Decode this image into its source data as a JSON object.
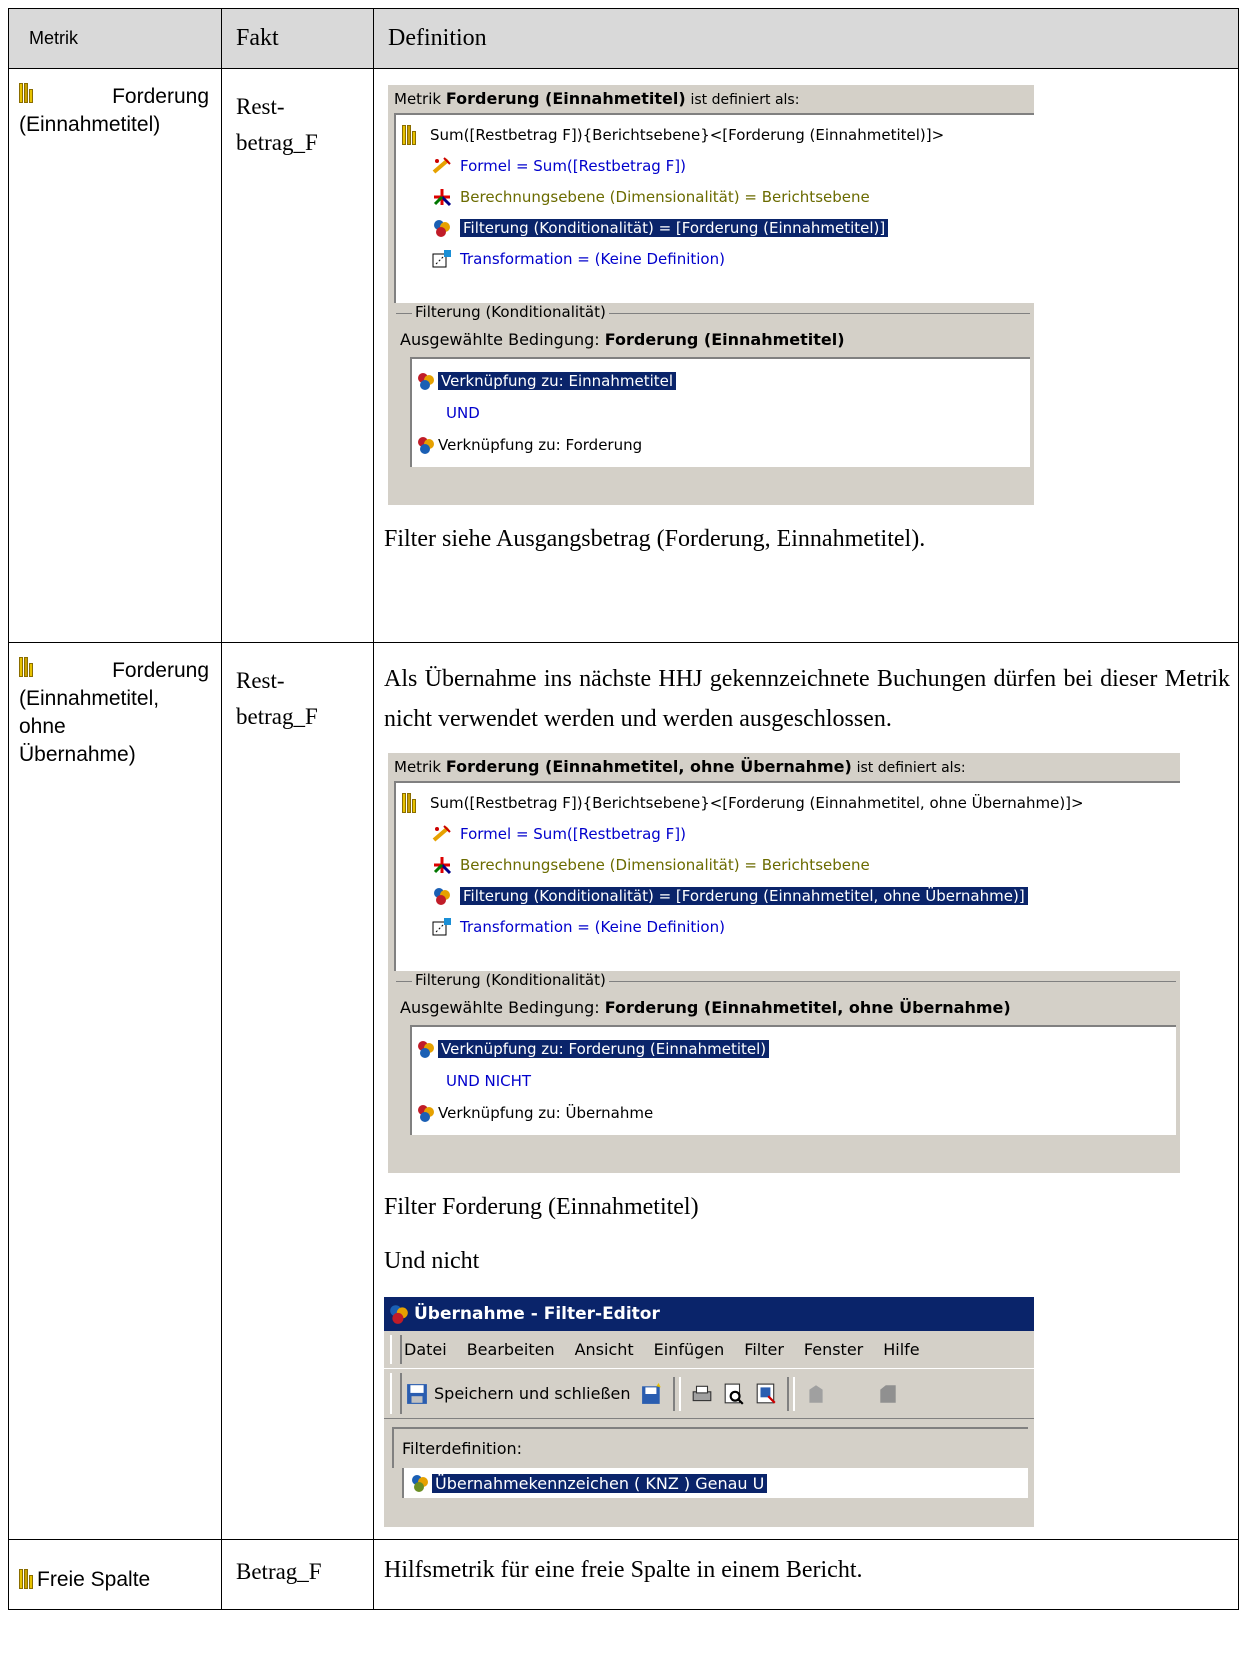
{
  "table": {
    "headers": {
      "metrik": "Metrik",
      "fakt": "Fakt",
      "definition": "Definition"
    },
    "rows": [
      {
        "metric_line1": "Forderung",
        "metric_line2": "(Einnahmetitel)",
        "fakt_line1": "Rest-",
        "fakt_line2": "betrag_F",
        "panel": {
          "header_prefix": "Metrik",
          "header_name": "Forderung (Einnahmetitel)",
          "header_suffix": "ist definiert als:",
          "tree_root": "Sum([Restbetrag F]){Berichtsebene}<[Forderung (Einnahmetitel)]>",
          "tree_formel": "Formel = Sum([Restbetrag F])",
          "tree_berechnung": "Berechnungsebene (Dimensionalität) = Berichtsebene",
          "tree_filterung": "Filterung (Konditionalität) = [Forderung (Einnahmetitel)]",
          "tree_transformation": "Transformation = (Keine Definition)",
          "group_title": "Filterung (Konditionalität)",
          "cond_label": "Ausgewählte Bedingung:",
          "cond_value": "Forderung (Einnahmetitel)",
          "cond_row1": "Verknüpfung zu: Einnahmetitel",
          "cond_op": "UND",
          "cond_row2": "Verknüpfung zu: Forderung"
        },
        "note": "Filter siehe Ausgangsbetrag (Forderung, Einnahmetitel)."
      },
      {
        "metric_line1": "Forderung",
        "metric_line2": "(Einnahmetitel,",
        "metric_line3": "ohne",
        "metric_line4": "Übernahme)",
        "fakt_line1": "Rest-",
        "fakt_line2": "betrag_F",
        "intro": "Als Übernahme ins nächste HHJ gekennzeichnete Buchungen dürfen bei dieser Metrik nicht verwendet werden und werden ausgeschlossen.",
        "panel": {
          "header_prefix": "Metrik",
          "header_name": "Forderung (Einnahmetitel, ohne Übernahme)",
          "header_suffix": "ist definiert als:",
          "tree_root": "Sum([Restbetrag F]){Berichtsebene}<[Forderung (Einnahmetitel, ohne Übernahme)]>",
          "tree_formel": "Formel = Sum([Restbetrag F])",
          "tree_berechnung": "Berechnungsebene (Dimensionalität) = Berichtsebene",
          "tree_filterung": "Filterung (Konditionalität) = [Forderung (Einnahmetitel, ohne Übernahme)]",
          "tree_transformation": "Transformation = (Keine Definition)",
          "group_title": "Filterung (Konditionalität)",
          "cond_label": "Ausgewählte Bedingung:",
          "cond_value": "Forderung (Einnahmetitel, ohne Übernahme)",
          "cond_row1": "Verknüpfung zu: Forderung (Einnahmetitel)",
          "cond_op": "UND NICHT",
          "cond_row2": "Verknüpfung zu: Übernahme"
        },
        "filter_line": "Filter Forderung (Einnahmetitel)",
        "und_nicht": "Und nicht",
        "editor": {
          "title": "Übernahme - Filter-Editor",
          "menu": [
            "Datei",
            "Bearbeiten",
            "Ansicht",
            "Einfügen",
            "Filter",
            "Fenster",
            "Hilfe"
          ],
          "save_label": "Speichern und schließen",
          "fdef_label": "Filterdefinition:",
          "fdef_value": "Übernahmekennzeichen ( KNZ ) Genau U"
        }
      },
      {
        "metric_line1": "Freie Spalte",
        "fakt_line1": "Betrag_F",
        "note": "Hilfsmetrik für eine freie Spalte in einem Bericht."
      }
    ]
  },
  "colors": {
    "header_bg": "#d9d9d9",
    "panel_bg": "#d4d0c8",
    "selection": "#0a246a",
    "link_blue": "#0000cc",
    "olive": "#6b6b00"
  },
  "icons": [
    "metric-icon",
    "formula-icon",
    "level-icon",
    "filter-icon",
    "transformation-icon",
    "filter-link-icon",
    "save-icon",
    "print-icon",
    "preview-icon",
    "find-icon"
  ]
}
